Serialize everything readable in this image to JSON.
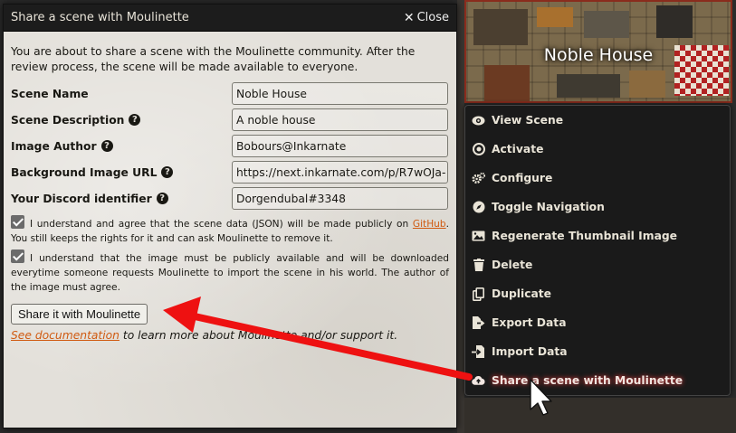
{
  "dialog": {
    "title": "Share a scene with Moulinette",
    "close_label": "Close",
    "intro": "You are about to share a scene with the Moulinette community. After the review process, the scene will be made available to everyone.",
    "fields": [
      {
        "label": "Scene Name",
        "value": "Noble House",
        "help": false
      },
      {
        "label": "Scene Description",
        "value": "A noble house",
        "help": true
      },
      {
        "label": "Image Author",
        "value": "Bobours@Inkarnate",
        "help": true
      },
      {
        "label": "Background Image URL",
        "value": "https://next.inkarnate.com/p/R7wOJa-",
        "help": true
      },
      {
        "label": "Your Discord identifier",
        "value": "Dorgendubal#3348",
        "help": true
      }
    ],
    "check1_text_a": "I understand and agree that the scene data (JSON) will be made publicly on ",
    "check1_link": "GitHub",
    "check1_text_b": ". You still keeps the rights for it and can ask Moulinette to remove it.",
    "check2_text": "I understand that the image must be publicly available and will be downloaded everytime someone requests Moulinette to import the scene in his world. The author of the image must agree.",
    "share_button": "Share it with Moulinette",
    "doc_link": "See documentation",
    "doc_text": " to learn more about Moulinette and/or support it."
  },
  "scene": {
    "title": "Noble House"
  },
  "context_menu": [
    {
      "label": "View Scene",
      "icon": "eye-icon"
    },
    {
      "label": "Activate",
      "icon": "target-icon"
    },
    {
      "label": "Configure",
      "icon": "cogs-icon"
    },
    {
      "label": "Toggle Navigation",
      "icon": "compass-icon"
    },
    {
      "label": "Regenerate Thumbnail Image",
      "icon": "image-icon"
    },
    {
      "label": "Delete",
      "icon": "trash-icon"
    },
    {
      "label": "Duplicate",
      "icon": "copy-icon"
    },
    {
      "label": "Export Data",
      "icon": "export-icon"
    },
    {
      "label": "Import Data",
      "icon": "import-icon"
    },
    {
      "label": "Share a scene with Moulinette",
      "icon": "cloud-upload-icon"
    }
  ],
  "colors": {
    "accent_link": "#d05a10",
    "arrow": "#ee1111",
    "dialog_header": "#1c1c1c"
  }
}
